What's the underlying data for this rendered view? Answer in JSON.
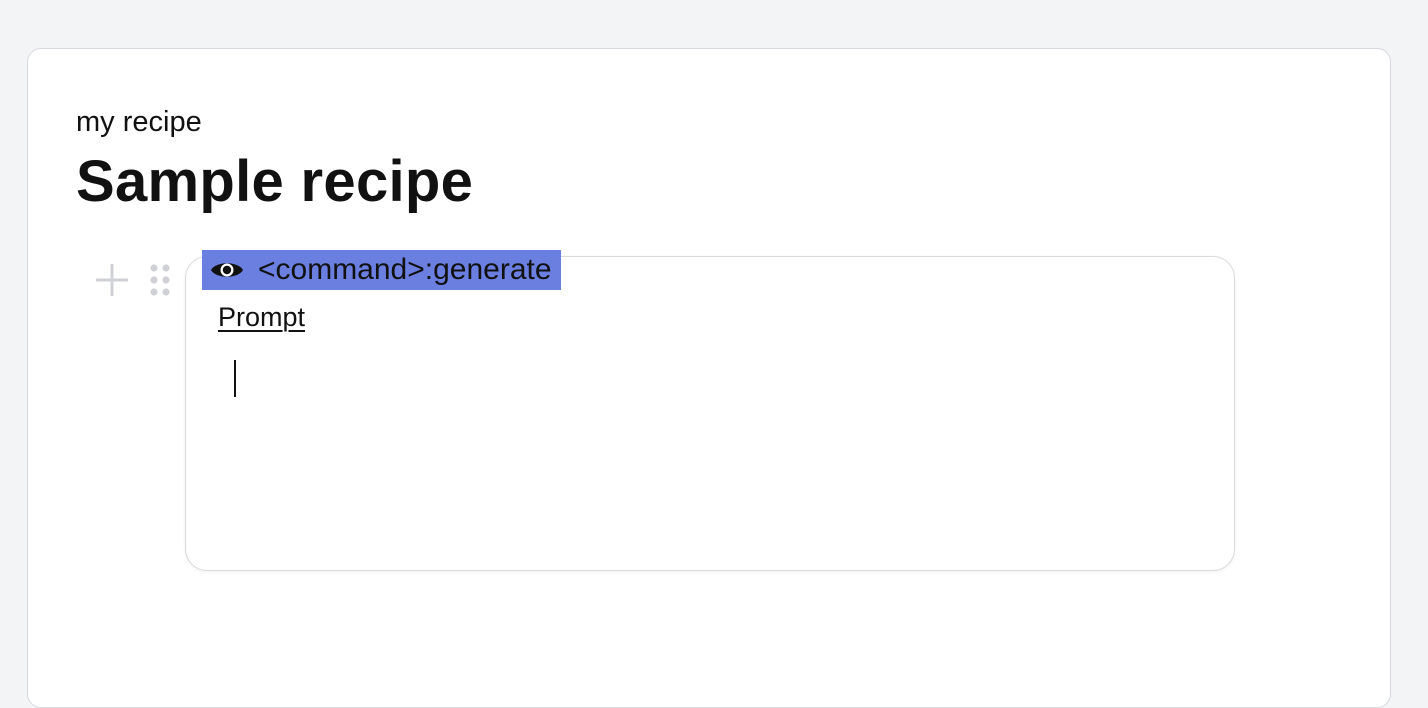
{
  "document": {
    "subtitle": "my recipe",
    "title": "Sample recipe"
  },
  "block": {
    "command_label": "<command>:generate",
    "command_icon": "eye-icon",
    "prompt_label": "Prompt",
    "prompt_value": ""
  },
  "controls": {
    "add_icon": "plus-icon",
    "drag_icon": "drag-dots-icon"
  },
  "colors": {
    "background": "#f3f4f6",
    "card": "#ffffff",
    "command_highlight": "#6b7fe0",
    "control_gray": "#cfd1d6"
  }
}
